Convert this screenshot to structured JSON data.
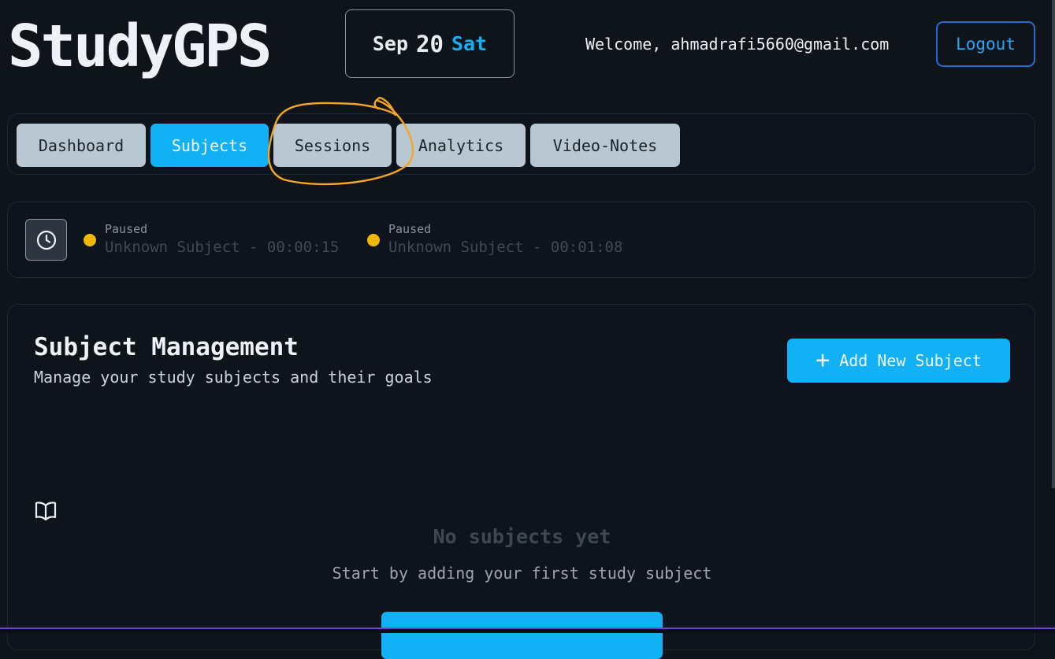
{
  "header": {
    "brand": "StudyGPS",
    "date": {
      "month": "Sep",
      "day": "20",
      "weekday": "Sat"
    },
    "welcome": "Welcome, ahmadrafi5660@gmail.com",
    "logout_label": "Logout"
  },
  "nav": {
    "tabs": [
      {
        "label": "Dashboard",
        "active": false
      },
      {
        "label": "Subjects",
        "active": true
      },
      {
        "label": "Sessions",
        "active": false
      },
      {
        "label": "Analytics",
        "active": false
      },
      {
        "label": "Video-Notes",
        "active": false
      }
    ]
  },
  "timers": [
    {
      "status": "Paused",
      "text": "Unknown Subject - 00:00:15"
    },
    {
      "status": "Paused",
      "text": "Unknown Subject - 00:01:08"
    }
  ],
  "subjects": {
    "title": "Subject Management",
    "subtitle": "Manage your study subjects and their goals",
    "add_label": "Add New Subject",
    "empty_title": "No subjects yet",
    "empty_subtitle": "Start by adding your first study subject"
  },
  "colors": {
    "accent": "#12b0f5",
    "background": "#0f131a",
    "paused_dot": "#f2b705",
    "annotation": "#f5a623"
  },
  "icons": [
    "clock-icon",
    "plus-icon",
    "book-open-icon"
  ]
}
